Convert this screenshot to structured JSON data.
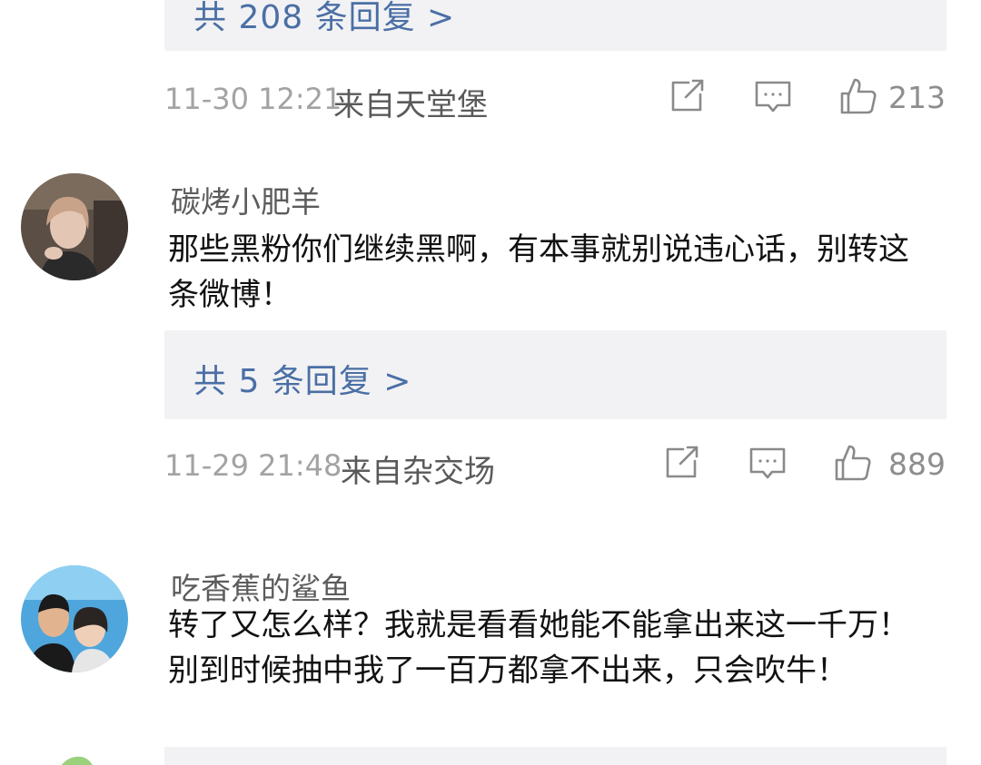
{
  "threads": [
    {
      "replies_label": "共 208 条回复 >",
      "time": "11-30 12:21",
      "source": "来自天堂堡",
      "likes": "213"
    },
    {
      "username": "碳烤小肥羊",
      "comment": "那些黑粉你们继续黑啊，有本事就别说违心话，别转这条微博！",
      "replies_label": "共 5 条回复 >",
      "time": "11-29 21:48",
      "source": "来自杂交场",
      "likes": "889"
    },
    {
      "username": "吃香蕉的鲨鱼",
      "comment": "转了又怎么样？我就是看看她能不能拿出来这一千万！别到时候抽中我了一百万都拿不出来，只会吹牛！"
    }
  ],
  "icons": {
    "share": "share-icon",
    "comment": "comment-icon",
    "like": "thumbs-up-icon"
  },
  "colors": {
    "link": "#4a6fa5",
    "reply_bg": "#f2f2f4",
    "meta_gray": "#a3a3a3"
  }
}
